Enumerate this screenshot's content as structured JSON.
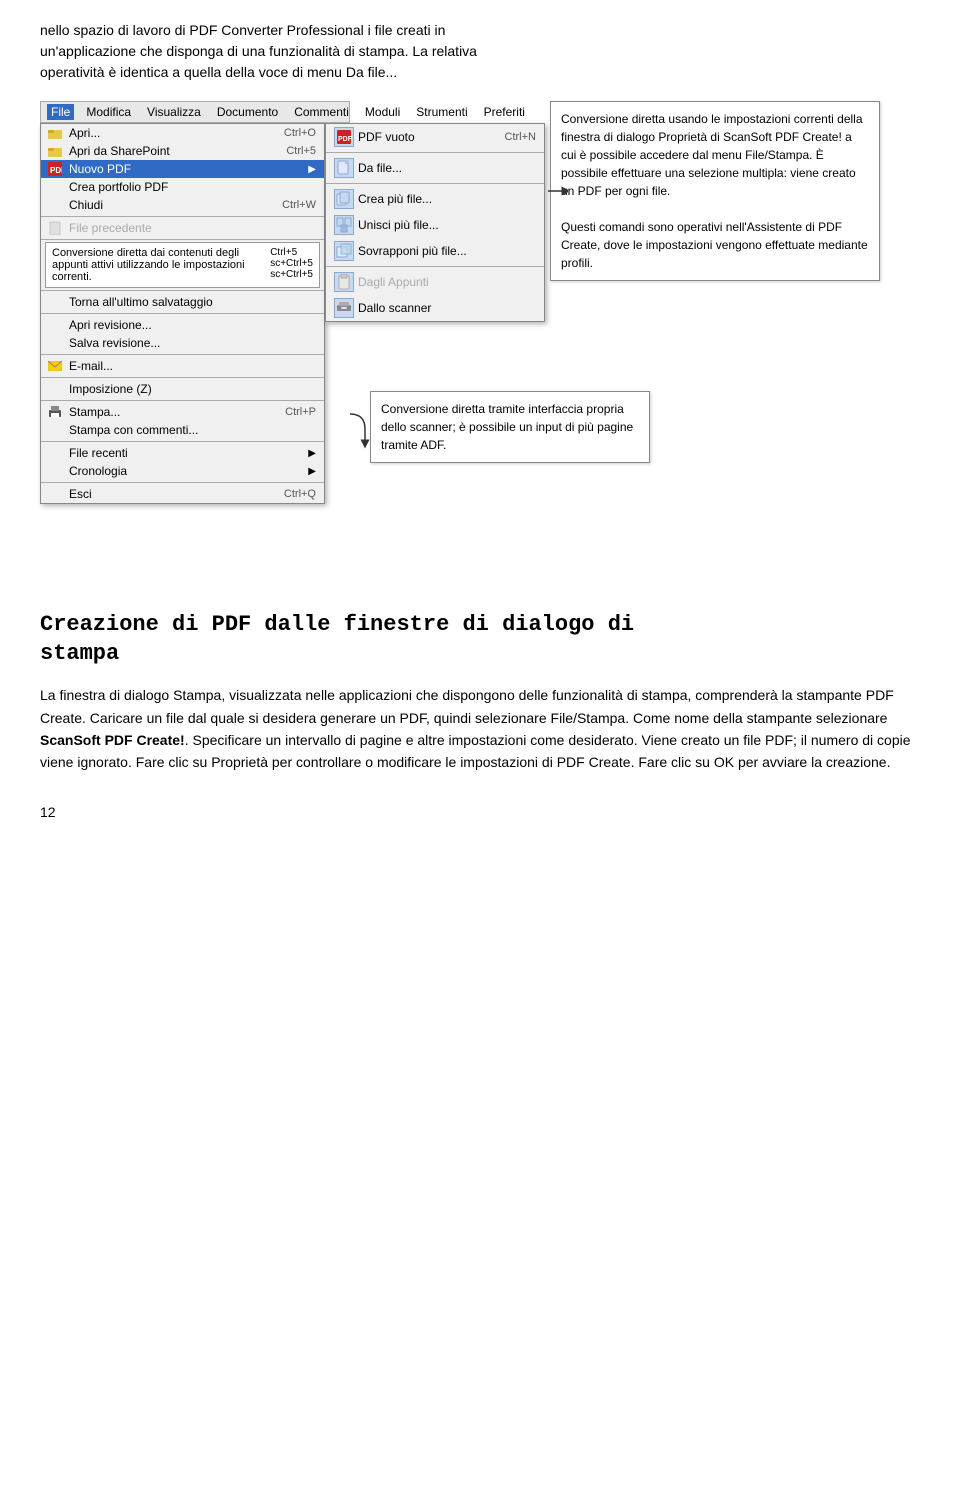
{
  "intro": {
    "line1": "nello spazio di lavoro di PDF Converter Professional i file creati in",
    "line2": "un'applicazione che disponga di una funzionalità di stampa. La relativa",
    "line3": "operatività è identica a quella della voce di menu Da file..."
  },
  "menubar": {
    "items": [
      "File",
      "Modifica",
      "Visualizza",
      "Documento",
      "Commenti",
      "Moduli",
      "Strumenti",
      "Preferiti"
    ]
  },
  "file_menu": {
    "items": [
      {
        "label": "Apri...",
        "shortcut": "Ctrl+O",
        "icon": "folder"
      },
      {
        "label": "Apri da SharePoint",
        "shortcut": "Ctrl+5",
        "icon": "folder"
      },
      {
        "label": "Nuovo PDF",
        "shortcut": "",
        "icon": "pdf",
        "highlighted": true,
        "has_arrow": true
      },
      {
        "label": "Crea portfolio PDF",
        "shortcut": "",
        "icon": ""
      },
      {
        "label": "Chiudi",
        "shortcut": "Ctrl+W",
        "icon": ""
      },
      {
        "separator": true
      },
      {
        "label": "File precedente",
        "shortcut": "",
        "disabled": true,
        "icon": ""
      },
      {
        "separator": true
      },
      {
        "label": "Conversione diretta dai contenuti degli appunti attivi utilizzando le impostazioni correnti.",
        "shortcut": "Ctrl+5",
        "icon": ""
      },
      {
        "separator": true
      },
      {
        "label": "Torna all'ultimo salvataggio",
        "shortcut": "",
        "icon": ""
      },
      {
        "separator": true
      },
      {
        "label": "Apri revisione...",
        "shortcut": "",
        "icon": ""
      },
      {
        "label": "Salva revisione...",
        "shortcut": "",
        "icon": ""
      },
      {
        "separator": true
      },
      {
        "label": "E-mail...",
        "shortcut": "",
        "icon": "email"
      },
      {
        "separator": true
      },
      {
        "label": "Imposizione (Z)",
        "shortcut": "",
        "icon": ""
      },
      {
        "separator": true
      },
      {
        "label": "Stampa...",
        "shortcut": "Ctrl+P",
        "icon": "print"
      },
      {
        "label": "Stampa con commenti...",
        "shortcut": "",
        "icon": ""
      },
      {
        "separator": true
      },
      {
        "label": "File recenti",
        "shortcut": "",
        "icon": "",
        "has_arrow": true
      },
      {
        "label": "Cronologia",
        "shortcut": "",
        "icon": "",
        "has_arrow": true
      },
      {
        "separator": true
      },
      {
        "label": "Esci",
        "shortcut": "Ctrl+Q",
        "icon": ""
      }
    ]
  },
  "nuovo_pdf_submenu": {
    "items": [
      {
        "label": "PDF vuoto",
        "shortcut": "Ctrl+N",
        "icon": "pdf_icon"
      },
      {
        "separator": true
      },
      {
        "label": "Da file...",
        "icon": "file_icon"
      },
      {
        "separator": true
      },
      {
        "label": "Crea più file...",
        "icon": "files_icon"
      },
      {
        "label": "Unisci più file...",
        "icon": "merge_icon"
      },
      {
        "label": "Sovrapponi più file...",
        "icon": "overlay_icon"
      },
      {
        "separator": true
      },
      {
        "label": "Dagli Appunti",
        "disabled": true,
        "icon": "clipboard_icon"
      },
      {
        "label": "Dallo scanner",
        "icon": "scanner_icon"
      }
    ]
  },
  "tooltip_right": {
    "text": "Conversione diretta usando le impostazioni correnti della finestra di dialogo Proprietà di ScanSoft PDF Create! a cui è possibile accedere dal menu File/Stampa. È possibile effettuare una selezione multipla: viene creato un PDF per ogni file.\n\nQuesti comandi sono operativi nell'Assistente di PDF Create, dove le impostazioni vengono effettuate mediante profili."
  },
  "tooltip_lower": {
    "text": "Conversione diretta tramite interfaccia propria dello scanner; è possibile un input di più pagine tramite ADF."
  },
  "callout_left": {
    "text": "Conversione diretta dai contenuti degli appunti attivi utilizzando le impostazioni correnti.",
    "shortcuts": [
      "Ctrl+5",
      "sc+Ctrl+5",
      "sc+Ctrl+5"
    ]
  },
  "section": {
    "heading_line1": "Creazione di PDF dalle finestre di dialogo di",
    "heading_line2": "stampa",
    "para1": "La finestra di dialogo Stampa, visualizzata nelle applicazioni che dispongono delle funzionalità di stampa, comprenderà la stampante PDF Create. Caricare un file dal quale si desidera generare un PDF, quindi selezionare File/Stampa. Come nome della stampante selezionare ScanSoft PDF Create!. Specificare un intervallo di pagine e altre impostazioni come desiderato. Viene creato un file PDF; il numero di copie viene ignorato. Fare clic su Proprietà per controllare o modificare le impostazioni di PDF Create. Fare clic su OK per avviare la creazione.",
    "bold_text": "ScanSoft PDF Create!"
  },
  "page_number": "12"
}
